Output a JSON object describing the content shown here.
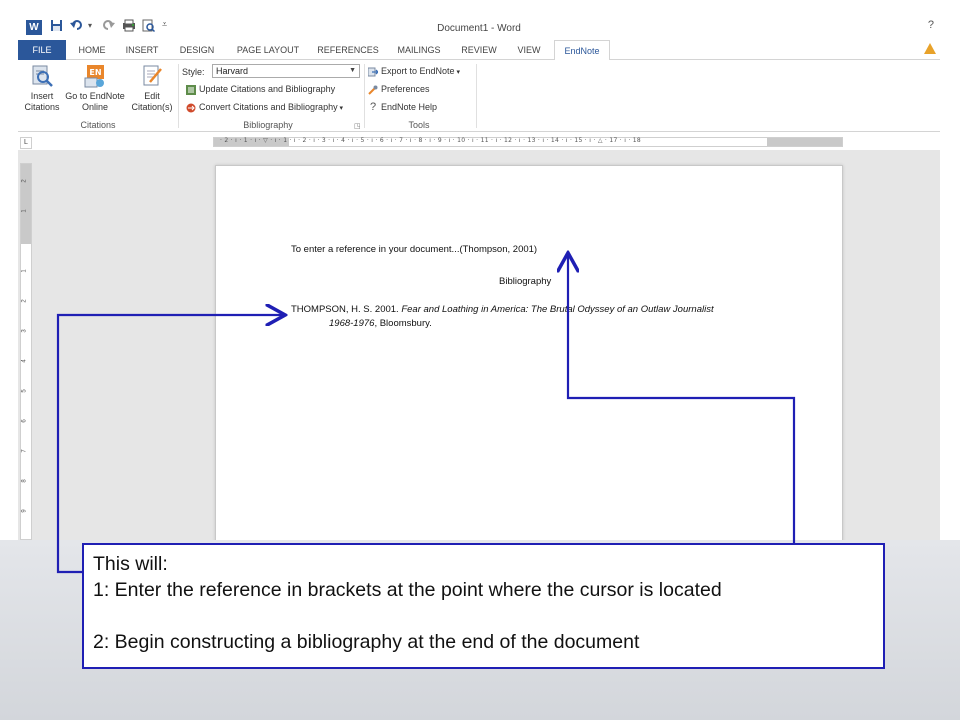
{
  "window": {
    "title": "Document1 - Word",
    "quick_access": [
      "save-icon",
      "undo-icon",
      "redo-icon",
      "print-icon",
      "print-preview-icon",
      "customize-icon"
    ]
  },
  "tabs": [
    {
      "label": "FILE"
    },
    {
      "label": "HOME"
    },
    {
      "label": "INSERT"
    },
    {
      "label": "DESIGN"
    },
    {
      "label": "PAGE LAYOUT"
    },
    {
      "label": "REFERENCES"
    },
    {
      "label": "MAILINGS"
    },
    {
      "label": "REVIEW"
    },
    {
      "label": "VIEW"
    },
    {
      "label": "EndNote"
    }
  ],
  "ribbon": {
    "citations": {
      "insert_l1": "Insert",
      "insert_l2": "Citations",
      "goto_l1": "Go to EndNote",
      "goto_l2": "Online",
      "edit_l1": "Edit",
      "edit_l2": "Citation(s)",
      "group_label": "Citations"
    },
    "bibliography": {
      "style_label": "Style:",
      "style_value": "Harvard",
      "update": "Update Citations and Bibliography",
      "convert": "Convert Citations and Bibliography",
      "group_label": "Bibliography"
    },
    "tools": {
      "export": "Export to EndNote",
      "preferences": "Preferences",
      "help": "EndNote Help",
      "group_label": "Tools"
    }
  },
  "ruler": {
    "horizontal": "· 2 · ı · 1 · ı · ▽ · ı · 1 · ı · 2 · ı · 3 · ı · 4 · ı · 5 · ı · 6 · ı · 7 · ı · 8 · ı · 9 · ı · 10 · ı · 11 · ı · 12 · ı · 13 · ı · 14 · ı · 15 · ı · △ · 17 · ı · 18",
    "vertical": [
      "2",
      "1",
      "1",
      "2",
      "3",
      "4",
      "5",
      "6",
      "7",
      "8",
      "9"
    ]
  },
  "document": {
    "line1": "To enter a reference in your document...(Thompson, 2001)",
    "bib_heading": "Bibliography",
    "ref_author": "THOMPSON, H. S. 2001. ",
    "ref_title_1": "Fear and Loathing in America: The Brutal Odyssey of an Outlaw Journalist",
    "ref_title_2": "1968-1976",
    "ref_publisher": ", Bloomsbury."
  },
  "callout": {
    "line1": "This will:",
    "line2": "1: Enter the reference in brackets at the point where the cursor is located",
    "line3": "2: Begin constructing a bibliography at the end of the document"
  },
  "colors": {
    "word_blue": "#2b579a",
    "annotation_blue": "#1f1fb4"
  }
}
